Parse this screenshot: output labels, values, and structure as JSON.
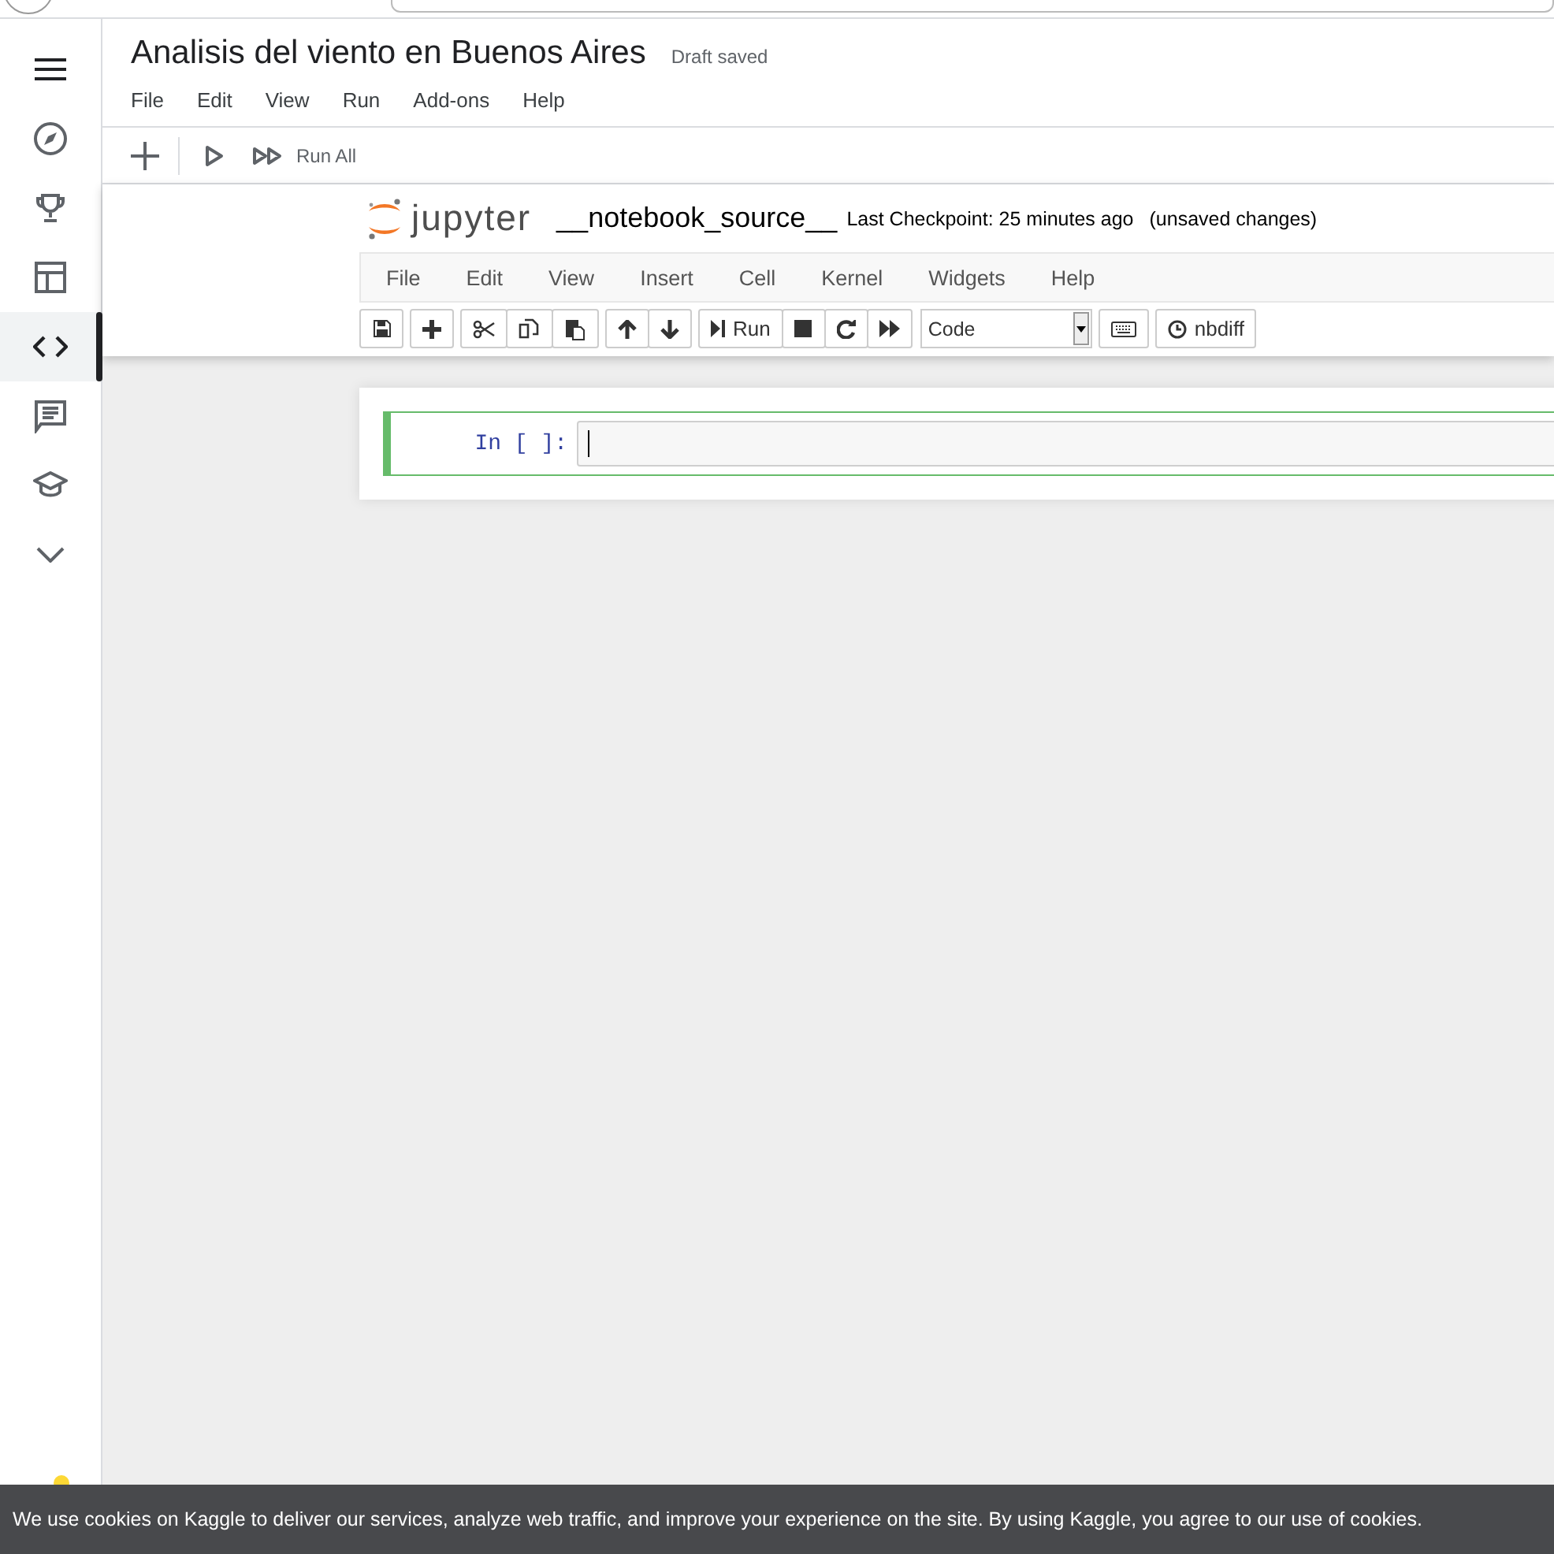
{
  "sidebar": {
    "items": [
      {
        "kind": "menu",
        "selected": false
      },
      {
        "kind": "compass",
        "selected": false
      },
      {
        "kind": "trophy",
        "selected": false
      },
      {
        "kind": "table",
        "selected": false
      },
      {
        "kind": "code",
        "selected": true
      },
      {
        "kind": "comments",
        "selected": false
      },
      {
        "kind": "school",
        "selected": false
      },
      {
        "kind": "more",
        "selected": false
      }
    ]
  },
  "editor": {
    "title": "Analisis del viento en Buenos Aires",
    "save_status": "Draft saved",
    "menu": [
      "File",
      "Edit",
      "View",
      "Run",
      "Add-ons",
      "Help"
    ],
    "run_all": "Run All"
  },
  "jupyter": {
    "logo": "jupyter",
    "notebook_name": "__notebook_source__",
    "checkpoint": "Last Checkpoint: 25 minutes ago",
    "unsaved": "(unsaved changes)",
    "menu": [
      "File",
      "Edit",
      "View",
      "Insert",
      "Cell",
      "Kernel",
      "Widgets",
      "Help"
    ],
    "toolbar": [
      [
        {
          "kind": "save"
        }
      ],
      [
        {
          "kind": "add"
        }
      ],
      [
        {
          "kind": "cut"
        },
        {
          "kind": "copy"
        },
        {
          "kind": "paste"
        }
      ],
      [
        {
          "kind": "up"
        },
        {
          "kind": "down"
        }
      ],
      [
        {
          "kind": "run",
          "label": "Run"
        },
        {
          "kind": "stop"
        },
        {
          "kind": "restart"
        },
        {
          "kind": "fastforward"
        }
      ],
      [
        {
          "kind": "select",
          "value": "Code"
        }
      ],
      [
        {
          "kind": "keyboard"
        }
      ],
      [
        {
          "kind": "clock",
          "label": "nbdiff"
        }
      ]
    ],
    "cell": {
      "prompt": "In [ ]:",
      "selected": true
    }
  },
  "cookie_banner": {
    "text": "We use cookies on Kaggle to deliver our services, analyze web traffic, and improve your experience on the site. By using Kaggle, you agree to our use of cookies."
  }
}
